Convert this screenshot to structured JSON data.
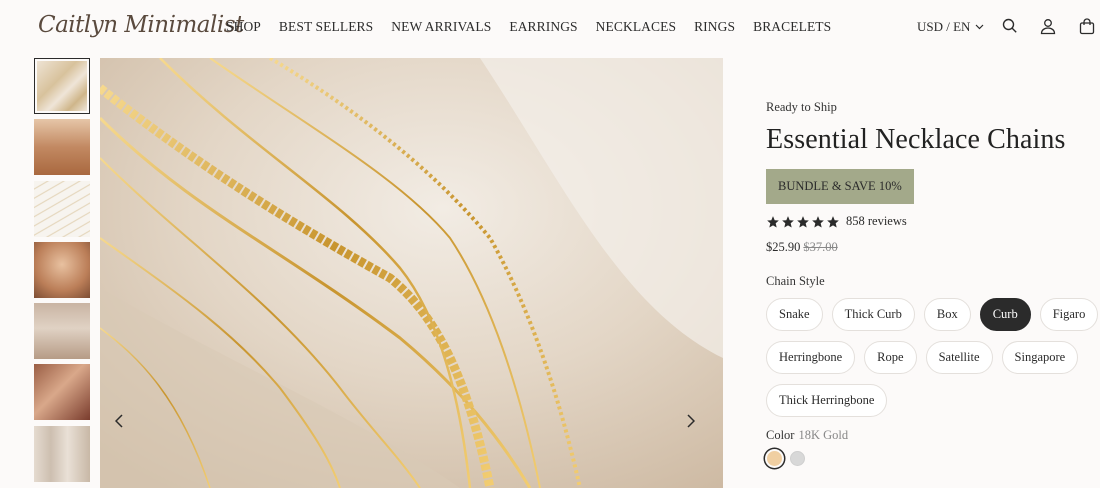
{
  "header": {
    "logo": "Caitlyn Minimalist",
    "nav": [
      "SHOP",
      "BEST SELLERS",
      "NEW ARRIVALS",
      "EARRINGS",
      "NECKLACES",
      "RINGS",
      "BRACELETS"
    ],
    "currency": "USD / EN"
  },
  "product": {
    "status": "Ready to Ship",
    "title": "Essential Necklace Chains",
    "promo": "BUNDLE & SAVE 10%",
    "rating": 5,
    "reviews": "858 reviews",
    "price": "$25.90",
    "price_original": "$37.00",
    "style_label": "Chain Style",
    "styles": [
      "Snake",
      "Thick Curb",
      "Box",
      "Curb",
      "Figaro",
      "Herringbone",
      "Rope",
      "Satellite",
      "Singapore",
      "Thick Herringbone"
    ],
    "selected_style": "Curb",
    "color_label": "Color",
    "color_value": "18K Gold",
    "swatch_colors": [
      "#f0cfa2",
      "#d8d8d8"
    ]
  },
  "gallery": {
    "thumbnail_count": 7,
    "active_index": 0
  }
}
